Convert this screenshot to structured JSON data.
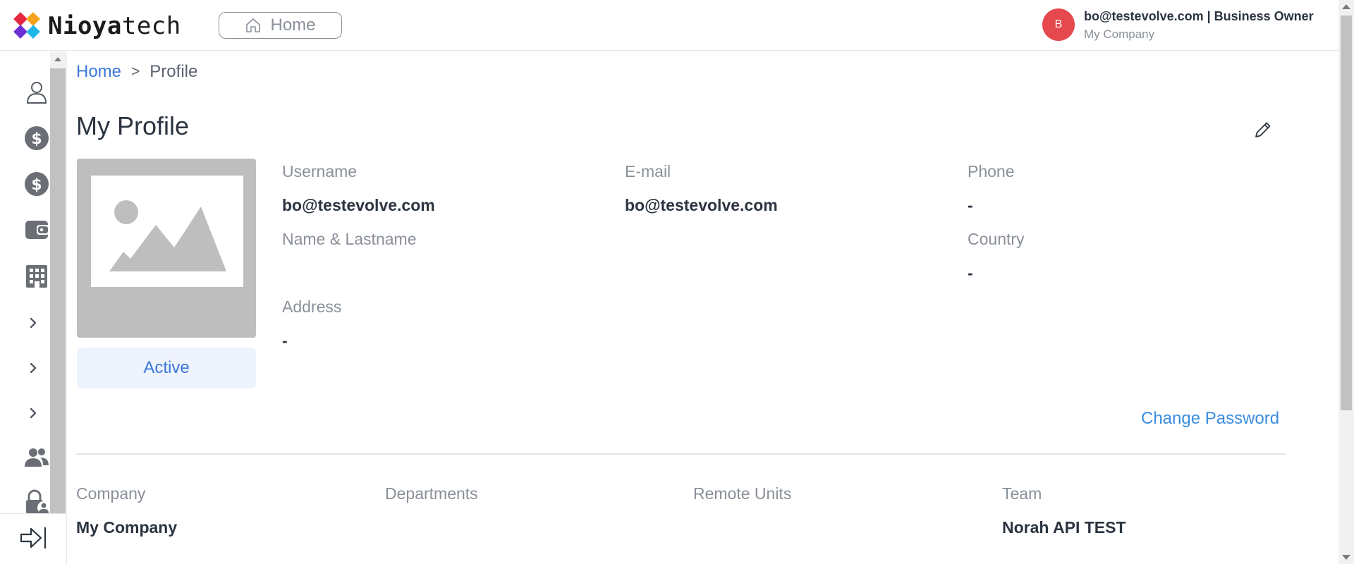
{
  "header": {
    "brand_bold": "Nioya",
    "brand_light": "tech",
    "home_label": "Home",
    "avatar_initial": "B",
    "user_line": "bo@testevolve.com | Business Owner",
    "company_line": "My Company"
  },
  "sidebar": {
    "icons": [
      "user-icon",
      "dollar-icon",
      "dollar-icon",
      "wallet-icon",
      "building-icon",
      "chevron-right-icon",
      "chevron-right-icon",
      "chevron-right-icon",
      "users-icon",
      "lock-user-icon"
    ],
    "collapse_icon": "collapse-sidebar-icon"
  },
  "breadcrumb": {
    "home": "Home",
    "separator": ">",
    "current": "Profile"
  },
  "profile": {
    "title": "My Profile",
    "status": "Active",
    "username_label": "Username",
    "username": "bo@testevolve.com",
    "email_label": "E-mail",
    "email": "bo@testevolve.com",
    "phone_label": "Phone",
    "phone": "-",
    "name_label": "Name & Lastname",
    "name": "",
    "country_label": "Country",
    "country": "-",
    "address_label": "Address",
    "address": "-",
    "change_password": "Change Password"
  },
  "organization": {
    "company_label": "Company",
    "company": "My Company",
    "departments_label": "Departments",
    "departments": "",
    "remote_units_label": "Remote Units",
    "remote_units": "",
    "team_label": "Team",
    "team": "Norah API TEST"
  },
  "colors": {
    "accent_blue": "#3a78d8",
    "link_blue": "#3a8de0",
    "avatar_red": "#e5484d",
    "text_dark": "#2b3440",
    "text_muted": "#8a9099"
  }
}
